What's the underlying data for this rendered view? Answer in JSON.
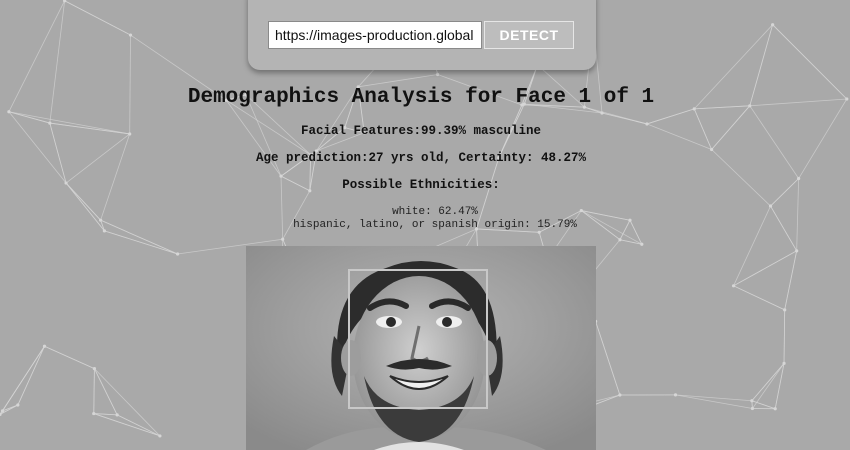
{
  "search": {
    "url_value": "https://images-production.global",
    "detect_label": "DETECT"
  },
  "analysis": {
    "title": "Demographics Analysis for Face 1 of 1",
    "facial_features": "Facial Features:99.39% masculine",
    "age_prediction": "Age prediction:27 yrs old, Certainty: 48.27%",
    "ethnicities_heading": "Possible Ethnicities:",
    "ethnicities": [
      "white: 62.47%",
      "hispanic, latino, or spanish origin: 15.79%"
    ]
  },
  "colors": {
    "background": "#a9a9a9",
    "network_lines": "#d6d6d6",
    "face_box": "#c8c8c8"
  }
}
